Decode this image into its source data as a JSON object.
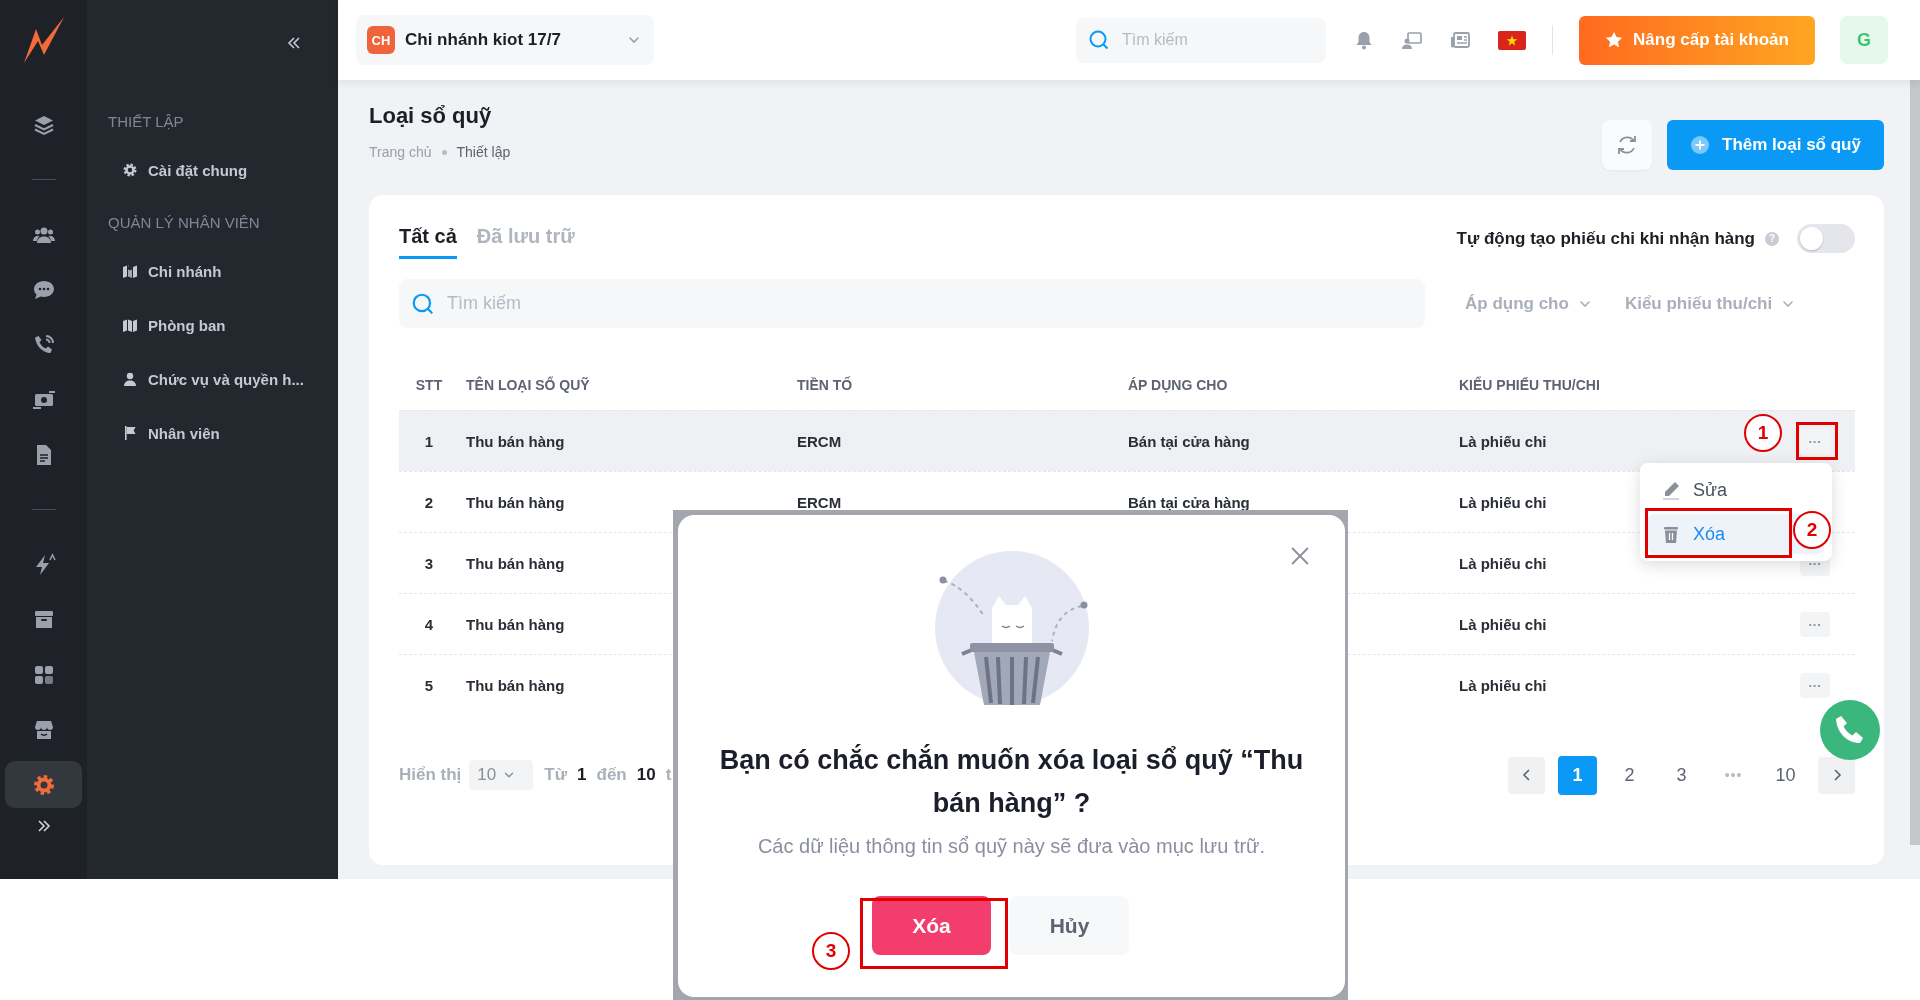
{
  "rail": {
    "items": [
      {
        "selected": false
      },
      {
        "selected": false
      },
      {
        "selected": false
      },
      {
        "selected": false
      },
      {
        "selected": false
      },
      {
        "selected": false
      },
      {
        "selected": false
      },
      {
        "selected": false
      },
      {
        "selected": false
      },
      {
        "selected": false
      },
      {
        "selected": true
      }
    ]
  },
  "sidebar": {
    "sections": [
      {
        "title": "THIẾT LẬP",
        "items": [
          {
            "label": "Cài đặt chung"
          }
        ]
      },
      {
        "title": "QUẢN LÝ NHÂN VIÊN",
        "items": [
          {
            "label": "Chi nhánh"
          },
          {
            "label": "Phòng ban"
          },
          {
            "label": "Chức vụ và quyền h..."
          },
          {
            "label": "Nhân viên"
          }
        ]
      }
    ]
  },
  "header": {
    "branch": {
      "badge": "CH",
      "name": "Chi nhánh kiot 17/7"
    },
    "search": {
      "placeholder": "Tìm kiếm"
    },
    "upgrade_button": "Nâng cấp tài khoản",
    "avatar": "G"
  },
  "page": {
    "title": "Loại sổ quỹ",
    "breadcrumb": [
      "Trang chủ",
      "Thiết lập"
    ],
    "add_button": "Thêm loại sổ quỹ"
  },
  "tabs": [
    {
      "label": "Tất cả",
      "selected": true
    },
    {
      "label": "Đã lưu trữ",
      "selected": false
    }
  ],
  "auto_toggle": {
    "label": "Tự động tạo phiếu chi khi nhận hàng",
    "help": "?",
    "on": false
  },
  "search": {
    "placeholder": "Tìm kiếm"
  },
  "filters": [
    "Áp dụng cho",
    "Kiểu phiếu thu/chi"
  ],
  "table": {
    "columns": [
      "STT",
      "TÊN LOẠI SỔ QUỸ",
      "TIỀN TỐ",
      "ÁP DỤNG CHO",
      "KIỂU PHIẾU THU/CHI"
    ],
    "rows": [
      {
        "stt": "1",
        "name": "Thu bán hàng",
        "prefix": "ERCM",
        "apply_to": "Bán tại cửa hàng",
        "type": "Là phiếu chi",
        "actions": "···",
        "selected": true
      },
      {
        "stt": "2",
        "name": "Thu bán hàng",
        "prefix": "ERCM",
        "apply_to": "Bán tại cửa hàng",
        "type": "Là phiếu chi",
        "selected": false
      },
      {
        "stt": "3",
        "name": "Thu bán hàng",
        "type": "Là phiếu chi",
        "actions": "···",
        "selected": false
      },
      {
        "stt": "4",
        "name": "Thu bán hàng",
        "type": "Là phiếu chi",
        "actions": "···",
        "selected": false
      },
      {
        "stt": "5",
        "name": "Thu bán hàng",
        "type": "Là phiếu chi",
        "actions": "···",
        "selected": false
      }
    ]
  },
  "pagination": {
    "label": "Hiển thị",
    "page_size": "10",
    "range": [
      {
        "text": "Từ",
        "kind": "word"
      },
      {
        "text": "1",
        "kind": "number"
      },
      {
        "text": "đến",
        "kind": "word"
      },
      {
        "text": "10",
        "kind": "number"
      },
      {
        "text": "t",
        "kind": "word"
      }
    ],
    "pages": [
      {
        "label": "1",
        "kind": "page",
        "selected": true
      },
      {
        "label": "2",
        "kind": "page",
        "selected": false
      },
      {
        "label": "3",
        "kind": "page",
        "selected": false
      },
      {
        "label": "•••",
        "kind": "ellipsis",
        "selected": false
      },
      {
        "label": "10",
        "kind": "page",
        "selected": false
      }
    ]
  },
  "row_menu": [
    {
      "label": "Sửa",
      "selected": false
    },
    {
      "label": "Xóa",
      "selected": true
    }
  ],
  "annotations": [
    {
      "label": "1"
    },
    {
      "label": "2"
    },
    {
      "label": "3"
    }
  ],
  "dialog": {
    "title": "Bạn có chắc chắn muốn xóa loại sổ quỹ “Thu bán hàng” ?",
    "message": "Các dữ liệu thông tin sổ quỹ này sẽ đưa vào mục lưu trữ.",
    "buttons": [
      {
        "label": "Xóa",
        "kind": "danger"
      },
      {
        "label": "Hủy",
        "kind": "secondary"
      }
    ]
  }
}
